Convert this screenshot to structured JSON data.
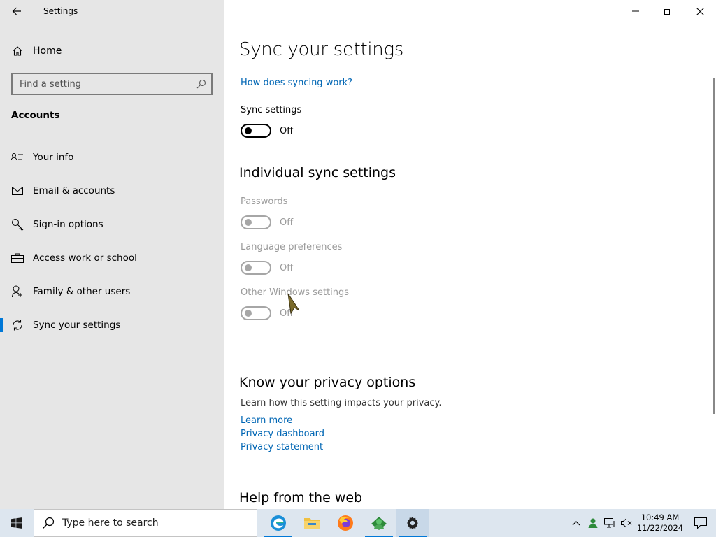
{
  "app": {
    "title": "Settings"
  },
  "sidebar": {
    "home_label": "Home",
    "search_placeholder": "Find a setting",
    "section_heading": "Accounts",
    "items": [
      {
        "label": "Your info",
        "icon": "person-card-icon"
      },
      {
        "label": "Email & accounts",
        "icon": "mail-icon"
      },
      {
        "label": "Sign-in options",
        "icon": "key-icon"
      },
      {
        "label": "Access work or school",
        "icon": "briefcase-icon"
      },
      {
        "label": "Family & other users",
        "icon": "person-add-icon"
      },
      {
        "label": "Sync your settings",
        "icon": "sync-icon",
        "selected": true
      }
    ]
  },
  "main": {
    "title": "Sync your settings",
    "how_link": "How does syncing work?",
    "sync": {
      "label": "Sync settings",
      "state": "Off"
    },
    "individual": {
      "heading": "Individual sync settings",
      "items": [
        {
          "label": "Passwords",
          "state": "Off"
        },
        {
          "label": "Language preferences",
          "state": "Off"
        },
        {
          "label": "Other Windows settings",
          "state": "Off"
        }
      ]
    },
    "privacy": {
      "heading": "Know your privacy options",
      "description": "Learn how this setting impacts your privacy.",
      "links": [
        "Learn more",
        "Privacy dashboard",
        "Privacy statement"
      ]
    },
    "help": {
      "heading": "Help from the web"
    }
  },
  "taskbar": {
    "search_text": "Type here to search",
    "clock_time": "10:49 AM",
    "clock_date": "11/22/2024"
  },
  "colors": {
    "accent": "#0078d7",
    "link": "#0066b4",
    "sidebar_bg": "#e6e6e6",
    "taskbar_bg": "#dde6ef"
  }
}
